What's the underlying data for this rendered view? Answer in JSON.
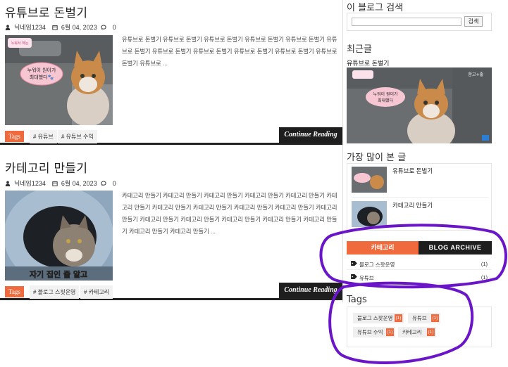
{
  "posts": [
    {
      "title": "유튜브로 돈벌기",
      "author": "닉네임1234",
      "date": "6월 04, 2023",
      "comments": "0",
      "excerpt": "유튜브로 돈벌기   유튜브로 돈벌기 유튜브로 돈벌기 유튜브로 돈벌기 유튜브로 돈벌기 유튜브로 돈벌기 유튜브로 돈벌기 유튜브로 돈벌기 유튜브로 돈벌기 유튜브로 돈벌기 유튜브로 돈벌기 유튜브로 ...",
      "thumb_caption_top": "누워서 하는 유튜브",
      "thumb_bubble": "누워이 원이가 최대했다 🐾",
      "tags_label": "Tags",
      "tags": [
        "# 유튜브",
        "# 유튜브 수익"
      ],
      "continue_label": "Continue Reading"
    },
    {
      "title": "카테고리 만들기",
      "author": "닉네임1234",
      "date": "6월 04, 2023",
      "comments": "0",
      "excerpt": "카테고리 만들기   카테고리 만들기 카테고리 만들기 카테고리 만들기 카테고리 만들기 카테고리 만들기 카테고리 만들기 카테고리 만들기 카테고리 만들기 카테고리 만들기 카테고리 만들기 카테고리 만들기 카테고리 만들기 카테고리 만들기 카테고리 만들기 카테고리 만들기 카테고리 만들기 카테고리 만들기 ...",
      "thumb_caption": "자기 집인 줄 알고",
      "tags_label": "Tags",
      "tags": [
        "# 블로그 스핏운영",
        "# 카테고리"
      ],
      "continue_label": "Continue Reading"
    }
  ],
  "sidebar": {
    "search_title": "이 블로그 검색",
    "search_button": "검색",
    "search_value": "",
    "recent_title": "최근글",
    "recent_link": "유튜브로 돈벌기",
    "recent_badge": "함고+좋",
    "popular_title": "가장 많이 본 글",
    "popular": [
      "유튜브로 돈벌기",
      "카테고리 만들기"
    ],
    "tabs": [
      "카테고리",
      "BLOG ARCHIVE"
    ],
    "categories": [
      {
        "label": "블로그 스팟운영",
        "count": "(1)"
      },
      {
        "label": "유튜브",
        "count": "(1)"
      }
    ],
    "tags_title": "Tags",
    "tags": [
      {
        "label": "블로그 스팟운영",
        "count": "(1)"
      },
      {
        "label": "유튜브",
        "count": "(1)"
      },
      {
        "label": "유튜브 수익",
        "count": "(1)"
      },
      {
        "label": "카테고리",
        "count": "(1)"
      }
    ]
  },
  "colors": {
    "accent": "#ef6a3c",
    "dark": "#1e1e1e",
    "annotation": "#6a16c8"
  }
}
